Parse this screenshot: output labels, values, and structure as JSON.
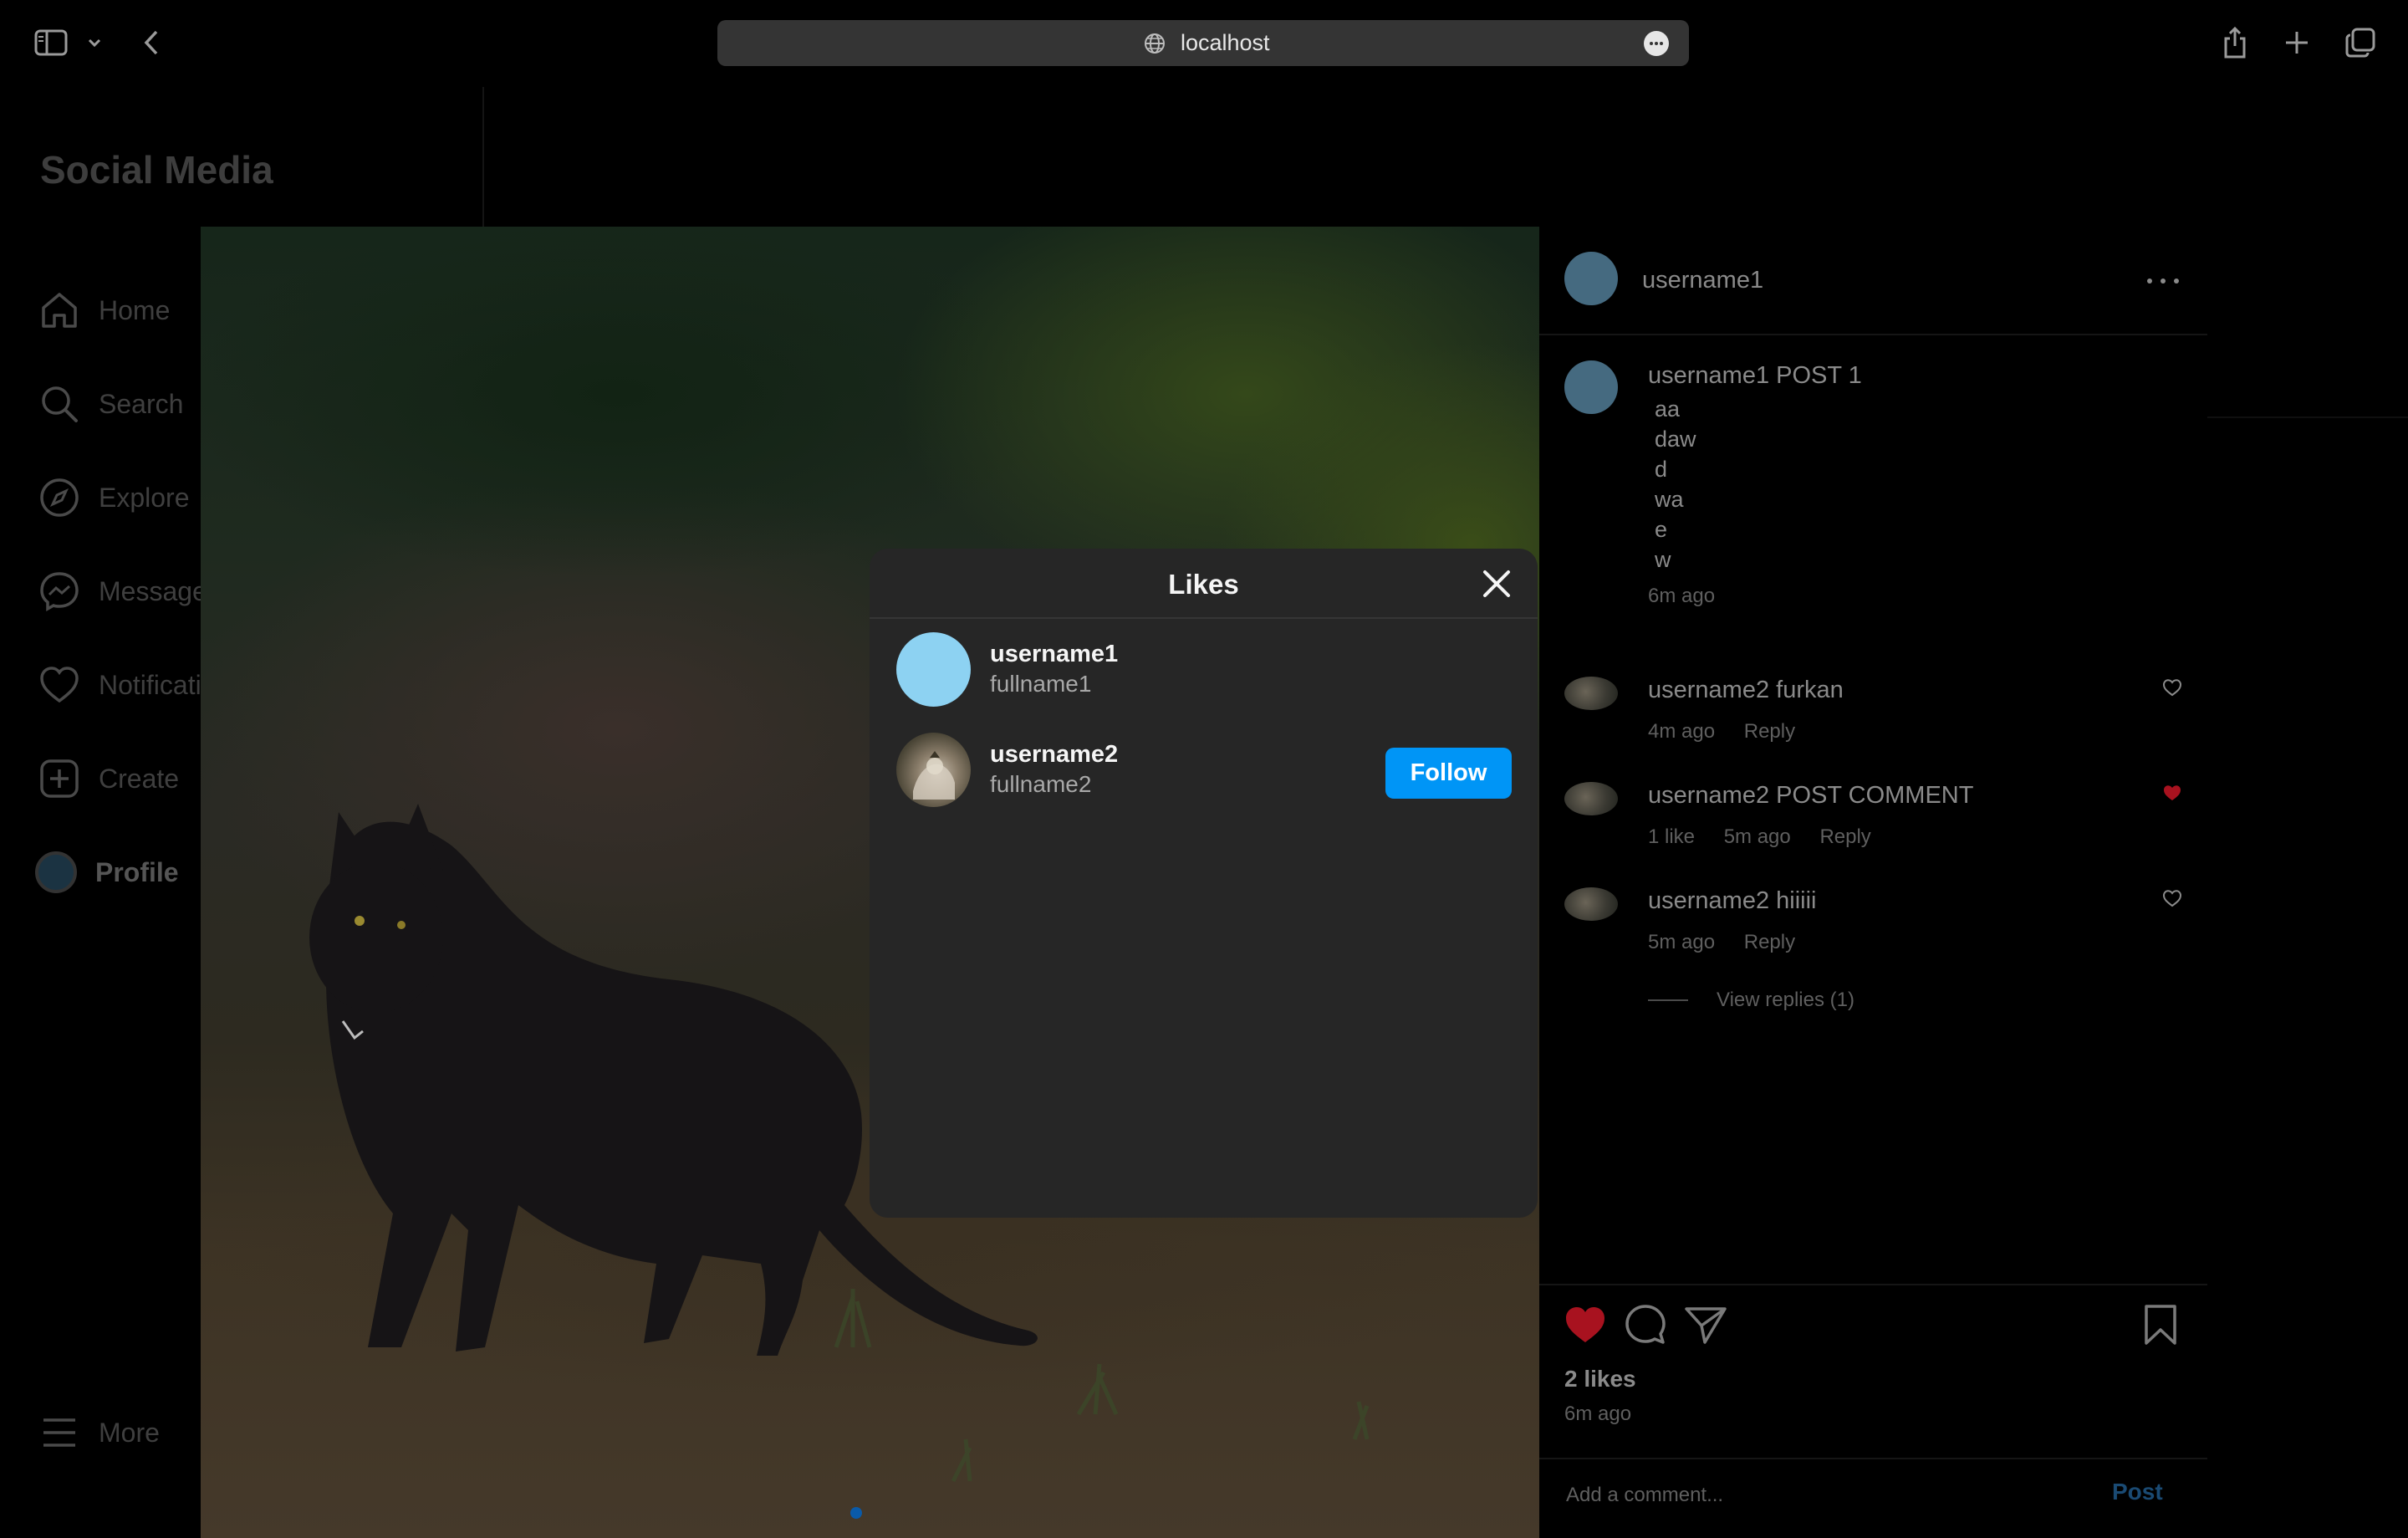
{
  "browser": {
    "url": "localhost"
  },
  "app": {
    "brand": "Social Media",
    "nav": [
      {
        "label": "Home",
        "icon": "home-icon"
      },
      {
        "label": "Search",
        "icon": "search-icon"
      },
      {
        "label": "Explore",
        "icon": "compass-icon"
      },
      {
        "label": "Messages",
        "icon": "messenger-icon"
      },
      {
        "label": "Notifications",
        "icon": "heart-icon"
      },
      {
        "label": "Create",
        "icon": "plus-square-icon"
      },
      {
        "label": "Profile",
        "icon": "avatar"
      }
    ],
    "more_label": "More"
  },
  "post": {
    "author": "username1",
    "caption": {
      "username": "username1",
      "text": "POST   1",
      "lines": [
        "aa",
        "daw",
        "d",
        "wa",
        "e",
        "w"
      ],
      "time": "6m ago"
    },
    "comments": [
      {
        "username": "username2",
        "text": "furkan",
        "likes": "",
        "time": "4m ago",
        "reply": "Reply",
        "liked": false
      },
      {
        "username": "username2",
        "text": "POST   COMMENT",
        "likes": "1 like",
        "time": "5m ago",
        "reply": "Reply",
        "liked": true
      },
      {
        "username": "username2",
        "text": "hiiiii",
        "likes": "",
        "time": "5m ago",
        "reply": "Reply",
        "liked": false
      }
    ],
    "view_replies": "View replies (1)",
    "likes_count": "2 likes",
    "time": "6m ago",
    "comment_placeholder": "Add a comment...",
    "post_button": "Post",
    "colors": {
      "liked_heart": "#c0172b",
      "follow_blue": "#0095f6"
    }
  },
  "likes_modal": {
    "title": "Likes",
    "users": [
      {
        "username": "username1",
        "fullname": "fullname1",
        "show_follow": false
      },
      {
        "username": "username2",
        "fullname": "fullname2",
        "show_follow": true,
        "follow_label": "Follow"
      }
    ]
  }
}
